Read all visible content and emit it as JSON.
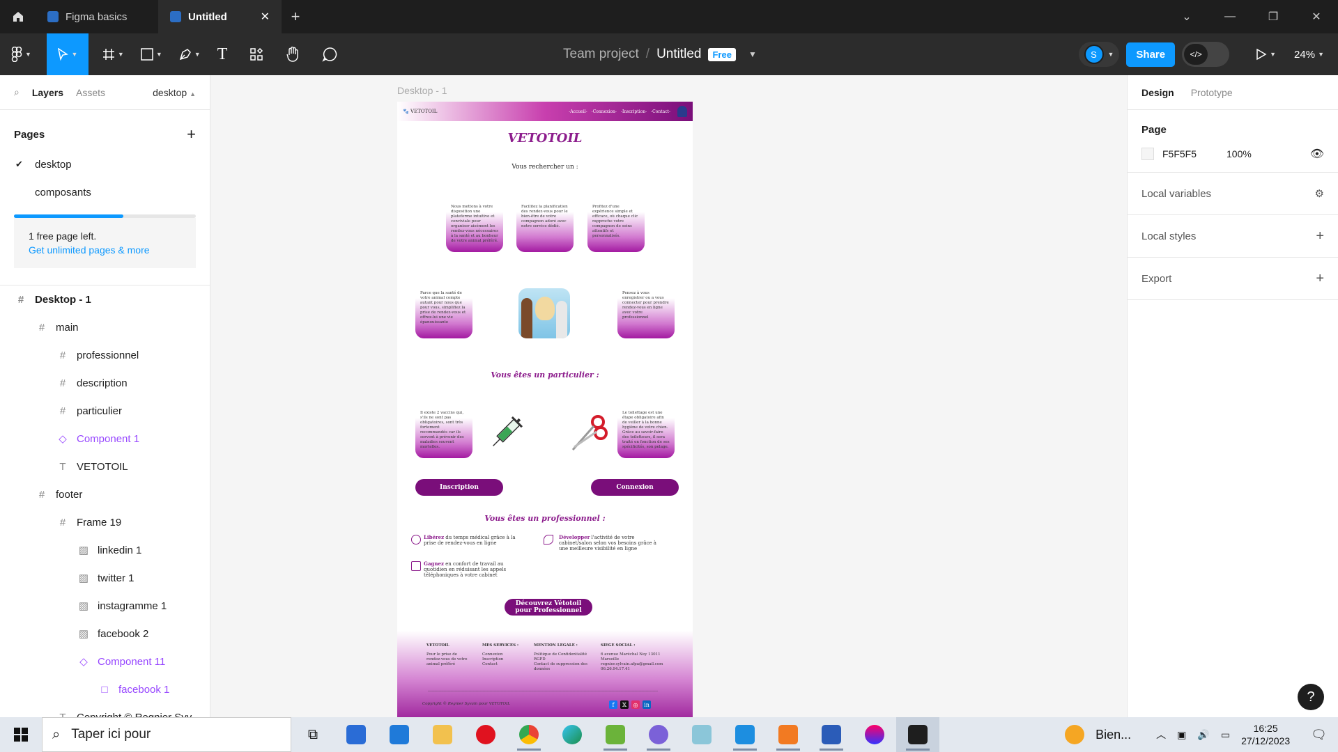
{
  "titlebar": {
    "tabs": [
      {
        "label": "Figma basics",
        "active": false
      },
      {
        "label": "Untitled",
        "active": true
      }
    ]
  },
  "toolbar": {
    "team": "Team project",
    "separator": "/",
    "file_name": "Untitled",
    "plan_badge": "Free",
    "avatar_initial": "S",
    "share_label": "Share",
    "zoom": "24%"
  },
  "left_panel": {
    "tabs": [
      "Layers",
      "Assets"
    ],
    "current_page": "desktop",
    "pages_heading": "Pages",
    "pages": [
      {
        "name": "desktop",
        "selected": true
      },
      {
        "name": "composants",
        "selected": false
      }
    ],
    "free_pages_text": "1 free page left.",
    "upgrade_link": "Get unlimited pages & more",
    "layers": [
      {
        "name": "Desktop - 1",
        "type": "frame",
        "depth": 0
      },
      {
        "name": "main",
        "type": "frame",
        "depth": 1
      },
      {
        "name": "professionnel",
        "type": "frame",
        "depth": 2
      },
      {
        "name": "description",
        "type": "frame",
        "depth": 2
      },
      {
        "name": "particulier",
        "type": "frame",
        "depth": 2
      },
      {
        "name": "Component 1",
        "type": "component",
        "depth": 2
      },
      {
        "name": "VETOTOIL",
        "type": "text",
        "depth": 2
      },
      {
        "name": "footer",
        "type": "frame",
        "depth": 1
      },
      {
        "name": "Frame 19",
        "type": "frame",
        "depth": 2
      },
      {
        "name": "linkedin 1",
        "type": "image",
        "depth": 3
      },
      {
        "name": "twitter 1",
        "type": "image",
        "depth": 3
      },
      {
        "name": "instagramme 1",
        "type": "image",
        "depth": 3
      },
      {
        "name": "facebook 2",
        "type": "image",
        "depth": 3
      },
      {
        "name": "Component 11",
        "type": "component",
        "depth": 3
      },
      {
        "name": "facebook 1",
        "type": "instance",
        "depth": 4
      },
      {
        "name": "Copyright © Regnier Syv...",
        "type": "text",
        "depth": 2
      }
    ]
  },
  "canvas": {
    "frame_label": "Desktop - 1",
    "site": {
      "logo_text": "VETOTOIL",
      "nav": [
        "-Accueil-",
        "-Connexion-",
        "-Inscription-",
        "-Contact-"
      ],
      "title": "VETOTOIL",
      "search_label": "Vous rechercher un :",
      "cards_top": [
        "Nous mettons à votre disposition une plateforme intuitive et conviviale pour organiser aisément les rendez-vous nécessaires à la santé et au bonheur de votre animal préféré.",
        "Facilitez la planification des rendez-vous pour le bien-être de votre compagnon adoré avec notre service dédié.",
        "Profitez d'une expérience simple et efficace, où chaque clic rapproche votre compagnon de soins attentifs et personnalisés."
      ],
      "card_mid_left": "Parce que la santé de votre animal compte autant pour nous que pour vous, simplifiez la prise de rendez-vous et offrez-lui une vie épanouissante",
      "card_mid_right": "Pensez à vous enregistrer ou a vous connecter pour prendre rendez-vous en ligne avec votre professionnel",
      "particulier_heading": "Vous êtes un particulier :",
      "card_vaccin": "Il existe 2 vaccins qui, s'ils ne sont pas obligatoires, sont très fortement recommandés car ils servent à prévenir des maladies souvent mortelles.",
      "card_toilettage": "Le toilettage est une étape obligatoire afin de veiller à la bonne hygiène de votre chien. Grâce au savoir-faire des toiletteurs, il sera traité en fonction de ses spécificités, son pelage.",
      "btn_inscription": "Inscription",
      "btn_connexion": "Connexion",
      "pro_heading": "Vous êtes un professionnel :",
      "pro_items": [
        {
          "bold": "Libérez",
          "text": " du temps médical grâce à la prise de rendez-vous en ligne"
        },
        {
          "bold": "Développer",
          "text": " l'activité de votre cabinet/salon selon vos besoins grâce à une meilleure visibilité en ligne"
        },
        {
          "bold": "Gagnez",
          "text": " en confort de travail au quotidien en réduisant les appels téléphoniques à votre cabinet"
        }
      ],
      "btn_pro": "Découvrez Vétotoil pour Professionnel",
      "footer": {
        "logo": "VETOTOIL",
        "tagline": "Pour le prise de rendez-vous de votre animal préféré",
        "services_heading": "MES SERVICES :",
        "services": [
          "Connexion",
          "Inscription",
          "Contact"
        ],
        "legal_heading": "MENTION LEGALE :",
        "legal": [
          "Politique de Confidentialité",
          "RGPD",
          "Contact de suppression des données"
        ],
        "office_heading": "SIEGE SOCIAL :",
        "office": [
          "6 avenue Maréchal Ney 13011 Marseille",
          "regnier.sylvain.afpa@gmail.com",
          "06.26.94.17.41"
        ],
        "copyright": "Copyright © Regnier Syvain pour VETOTOIL"
      }
    }
  },
  "right_panel": {
    "tabs": [
      "Design",
      "Prototype"
    ],
    "page_heading": "Page",
    "page_color": "F5F5F5",
    "page_opacity": "100%",
    "sections": [
      "Local variables",
      "Local styles",
      "Export"
    ]
  },
  "taskbar": {
    "search_placeholder": "Taper ici pour",
    "weather": "Bien...",
    "time": "16:25",
    "date": "27/12/2023"
  },
  "colors": {
    "accent": "#0d99ff",
    "site_purple": "#8c1c8c",
    "component": "#9747ff"
  }
}
